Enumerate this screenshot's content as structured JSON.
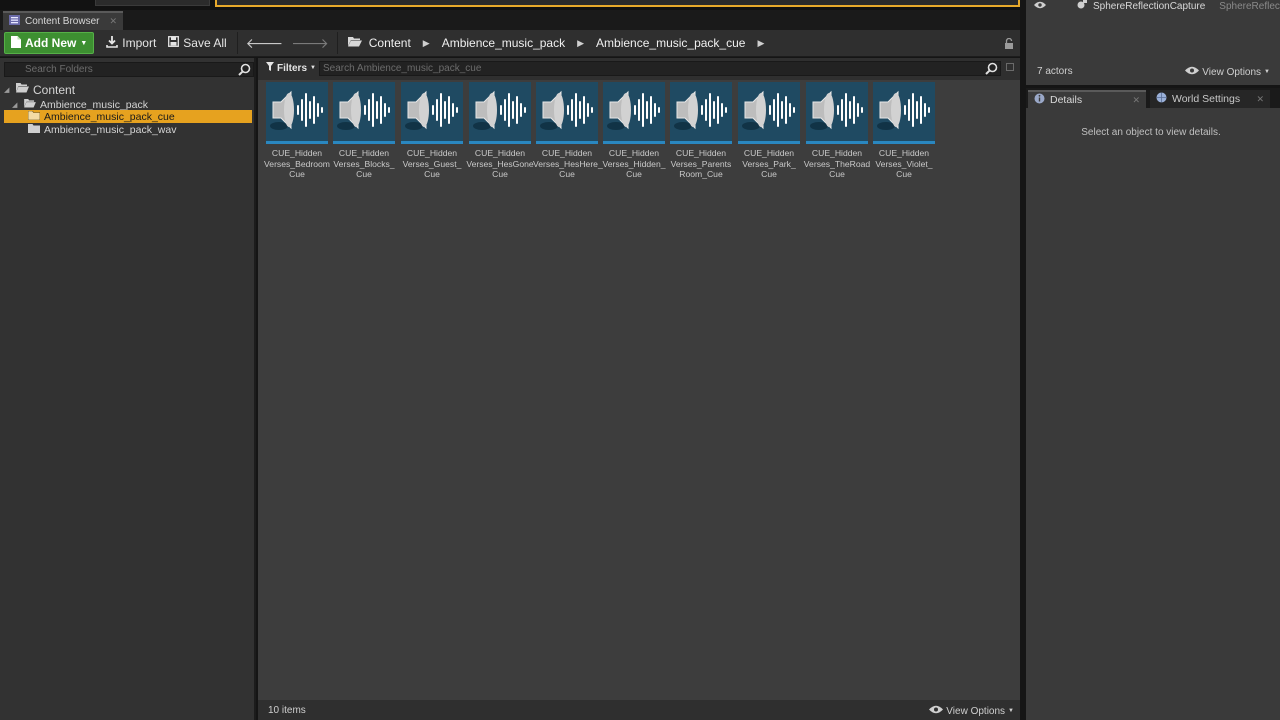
{
  "window": {
    "tab_label": "Content Browser"
  },
  "toolbar": {
    "add_new_label": "Add New",
    "import_label": "Import",
    "save_all_label": "Save All",
    "breadcrumbs": [
      "Content",
      "Ambience_music_pack",
      "Ambience_music_pack_cue"
    ]
  },
  "folders": {
    "search_placeholder": "Search Folders",
    "items": [
      {
        "label": "Content"
      },
      {
        "label": "Ambience_music_pack"
      },
      {
        "label": "Ambience_music_pack_cue"
      },
      {
        "label": "Ambience_music_pack_wav"
      }
    ]
  },
  "assets": {
    "filters_label": "Filters",
    "search_placeholder": "Search Ambience_music_pack_cue",
    "tiles": [
      {
        "name": [
          "CUE_Hidden",
          "Verses_Bedroom",
          "Cue"
        ]
      },
      {
        "name": [
          "CUE_Hidden",
          "Verses_Blocks_",
          "Cue"
        ]
      },
      {
        "name": [
          "CUE_Hidden",
          "Verses_Guest_",
          "Cue"
        ]
      },
      {
        "name": [
          "CUE_Hidden",
          "Verses_HesGone",
          "Cue"
        ]
      },
      {
        "name": [
          "CUE_Hidden",
          "Verses_HesHere_",
          "Cue"
        ]
      },
      {
        "name": [
          "CUE_Hidden",
          "Verses_Hidden_",
          "Cue"
        ]
      },
      {
        "name": [
          "CUE_Hidden",
          "Verses_Parents",
          "Room_Cue"
        ]
      },
      {
        "name": [
          "CUE_Hidden",
          "Verses_Park_",
          "Cue"
        ]
      },
      {
        "name": [
          "CUE_Hidden",
          "Verses_TheRoad",
          "Cue"
        ]
      },
      {
        "name": [
          "CUE_Hidden",
          "Verses_Violet_",
          "Cue"
        ]
      }
    ],
    "item_count": "10 items",
    "view_options_label": "View Options"
  },
  "outliner": {
    "row_name": "SphereReflectionCapture",
    "row_type": "SphereReflectic",
    "actor_count": "7 actors",
    "view_options_label": "View Options"
  },
  "details": {
    "tab_details": "Details",
    "tab_world": "World Settings",
    "empty_message": "Select an object to view details."
  },
  "colors": {
    "accent_selection": "#e6a21f",
    "add_new_green": "#3d8f31",
    "asset_thumb": "#1f4a62"
  }
}
